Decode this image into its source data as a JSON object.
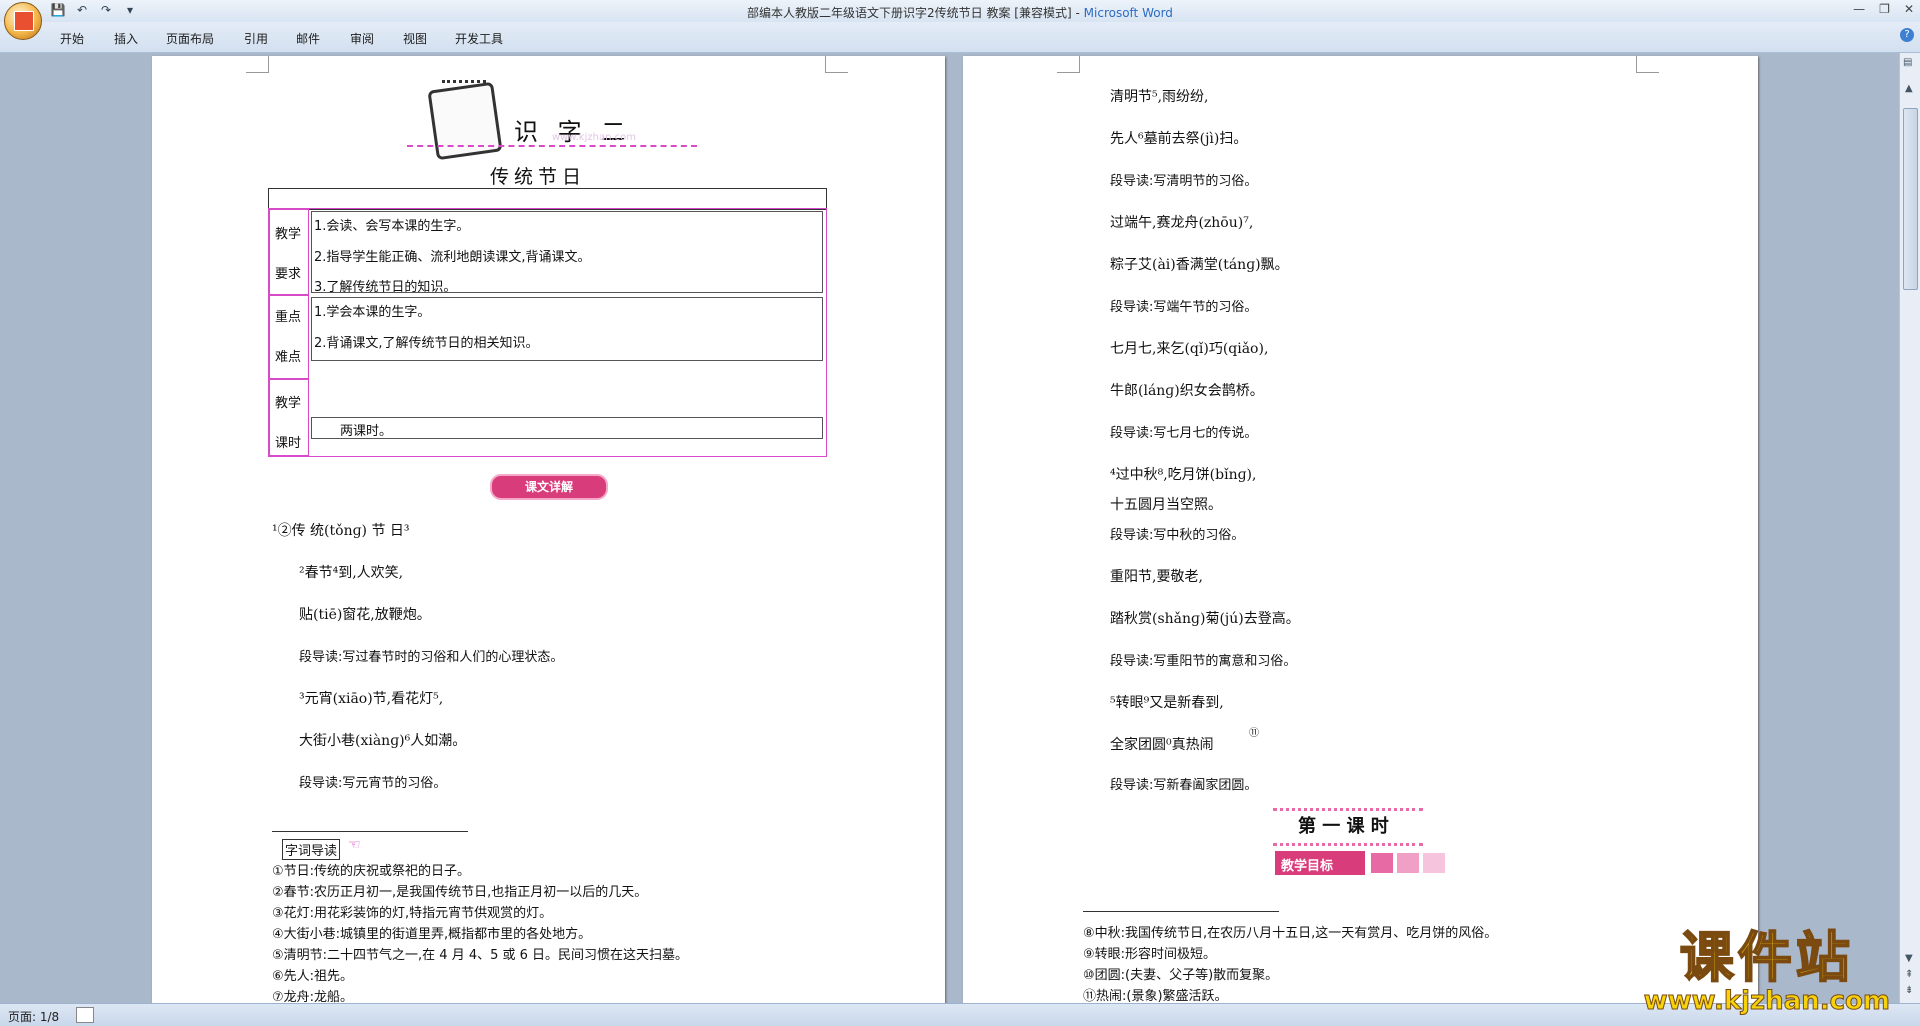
{
  "window": {
    "title": "部编本人教版二年级语文下册识字2传统节日 教案 [兼容模式] -",
    "app": "Microsoft Word"
  },
  "ribbon": {
    "tabs": [
      "开始",
      "插入",
      "页面布局",
      "引用",
      "邮件",
      "审阅",
      "视图",
      "开发工具"
    ]
  },
  "page1": {
    "header": "识  字  二",
    "header_watermark": "www.kjzhan.com",
    "lesson_title": "传统节日",
    "table": {
      "goals_label": [
        "教学",
        "要求"
      ],
      "goals": [
        "1.会读、会写本课的生字。",
        "2.指导学生能正确、流利地朗读课文,背诵课文。",
        "3.了解传统节日的知识。"
      ],
      "key_label": [
        "重点",
        "难点"
      ],
      "key": [
        "1.学会本课的生字。",
        "2.背诵课文,了解传统节日的相关知识。"
      ],
      "hours_label": [
        "教学",
        "课时"
      ],
      "hours": "两课时。"
    },
    "badge": "课文详解",
    "text_lines": [
      "¹②传 统(tǒnɡ) 节 日³",
      "²春节⁴到,人欢笑,",
      "贴(tiē)窗花,放鞭炮。",
      "段导读:写过春节时的习俗和人们的心理状态。",
      "³元宵(xiāo)节,看花灯⁵,",
      "大街小巷(xiànɡ)⁶人如潮。",
      "段导读:写元宵节的习俗。"
    ],
    "footnote_title": "字词导读",
    "footnotes": [
      "①节日:传统的庆祝或祭祀的日子。",
      "②春节:农历正月初一,是我国传统节日,也指正月初一以后的几天。",
      "③花灯:用花彩装饰的灯,特指元宵节供观赏的灯。",
      "④大街小巷:城镇里的街道里弄,概指都市里的各处地方。",
      "⑤清明节:二十四节气之一,在 4 月 4、5 或 6 日。民间习惯在这天扫墓。",
      "⑥先人:祖先。",
      "⑦龙舟:龙船。"
    ]
  },
  "page2": {
    "text_lines": [
      "清明节⁵,雨纷纷,",
      "先人⁶墓前去祭(jì)扫。",
      "段导读:写清明节的习俗。",
      "过端午,赛龙舟(zhōu)⁷,",
      "粽子艾(ài)香满堂(tánɡ)飘。",
      "段导读:写端午节的习俗。",
      "七月七,来乞(qǐ)巧(qiǎo),",
      "牛郎(lánɡ)织女会鹊桥。",
      "段导读:写七月七的传说。",
      "⁴过中秋⁸,吃月饼(bǐnɡ),",
      "十五圆月当空照。",
      "段导读:写中秋的习俗。",
      "重阳节,要敬老,",
      "踏秋赏(shǎnɡ)菊(jú)去登高。",
      "段导读:写重阳节的寓意和习俗。",
      "⁵转眼⁹又是新春到,",
      "全家团圆⁰真热闹",
      "段导读:写新春阖家团圆。"
    ],
    "superscript_eleven": "⑪",
    "lesson_heading": "第 一 课 时",
    "goal_badge": "教学目标",
    "footnotes": [
      "⑧中秋:我国传统节日,在农历八月十五日,这一天有赏月、吃月饼的风俗。",
      "⑨转眼:形容时间极短。",
      "⑩团圆:(夫妻、父子等)散而复聚。",
      "⑪热闹:(景象)繁盛活跃。"
    ]
  },
  "statusbar": {
    "page": "页面: 1/8"
  },
  "watermark": {
    "big": "课件站",
    "url": "www.kjzhan.com"
  },
  "colors": {
    "accent_pink": "#d84bc8",
    "badge_pink": "#d83c7a",
    "watermark_yellow": "#f5d20a"
  }
}
